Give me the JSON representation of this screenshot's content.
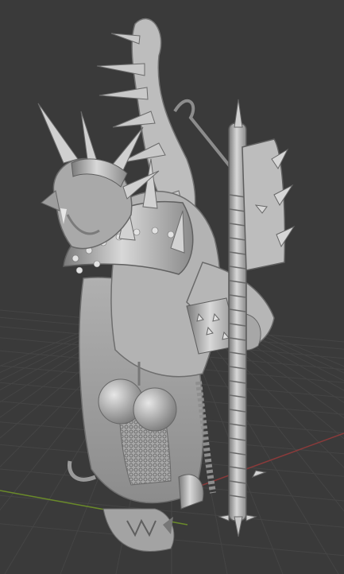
{
  "viewport": {
    "background": "#3a3a3a",
    "grid_color": "#454545",
    "x_axis_color": "#8a3a3a",
    "y_axis_color": "#6a8a2a"
  },
  "model": {
    "subject": "armored-ratman-warrior-sculpt",
    "material_color": "#b9b9b9",
    "shadow_color": "#6e6e6e",
    "highlight_color": "#e4e4e4"
  }
}
